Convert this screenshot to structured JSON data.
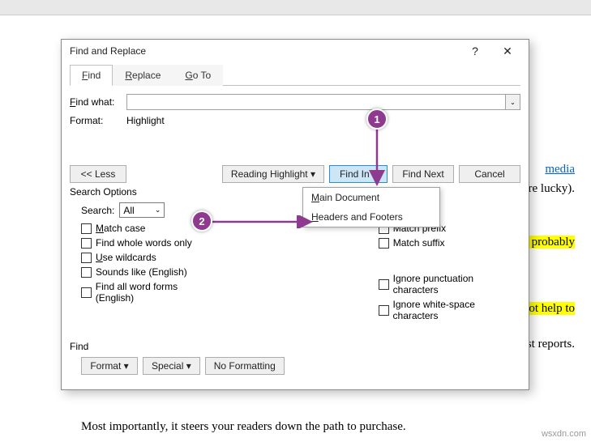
{
  "dialog": {
    "title": "Find and Replace",
    "help": "?",
    "close": "✕",
    "tabs": {
      "find": "Find",
      "replace": "Replace",
      "goto": "Go To"
    },
    "findwhat_label": "Find what:",
    "findwhat_value": "",
    "format_label": "Format:",
    "format_value": "Highlight",
    "buttons": {
      "less": "<< Less",
      "reading_highlight": "Reading Highlight ▾",
      "find_in": "Find In ▾",
      "find_next": "Find Next",
      "cancel": "Cancel"
    },
    "findin_menu": {
      "main_document": "Main Document",
      "headers_footers": "Headers and Footers"
    },
    "search_options_label": "Search Options",
    "search_label": "Search:",
    "search_value": "All",
    "options_left": [
      "Match case",
      "Find whole words only",
      "Use wildcards",
      "Sounds like (English)",
      "Find all word forms (English)"
    ],
    "options_right": [
      "Match prefix",
      "Match suffix",
      "Ignore punctuation characters",
      "Ignore white-space characters"
    ],
    "find_group_label": "Find",
    "bottom_buttons": {
      "format": "Format ▾",
      "special": "Special ▾",
      "no_formatting": "No Formatting"
    }
  },
  "doc": {
    "line1_link": "media",
    "line2": " you're lucky).",
    "line3": "which probably",
    "line4": "ill not help to",
    "line5": "e latest reports.",
    "line6": "Most importantly, it steers your readers down the path to purchase."
  },
  "callouts": {
    "one": "1",
    "two": "2"
  },
  "watermark": "wsxdn.com"
}
